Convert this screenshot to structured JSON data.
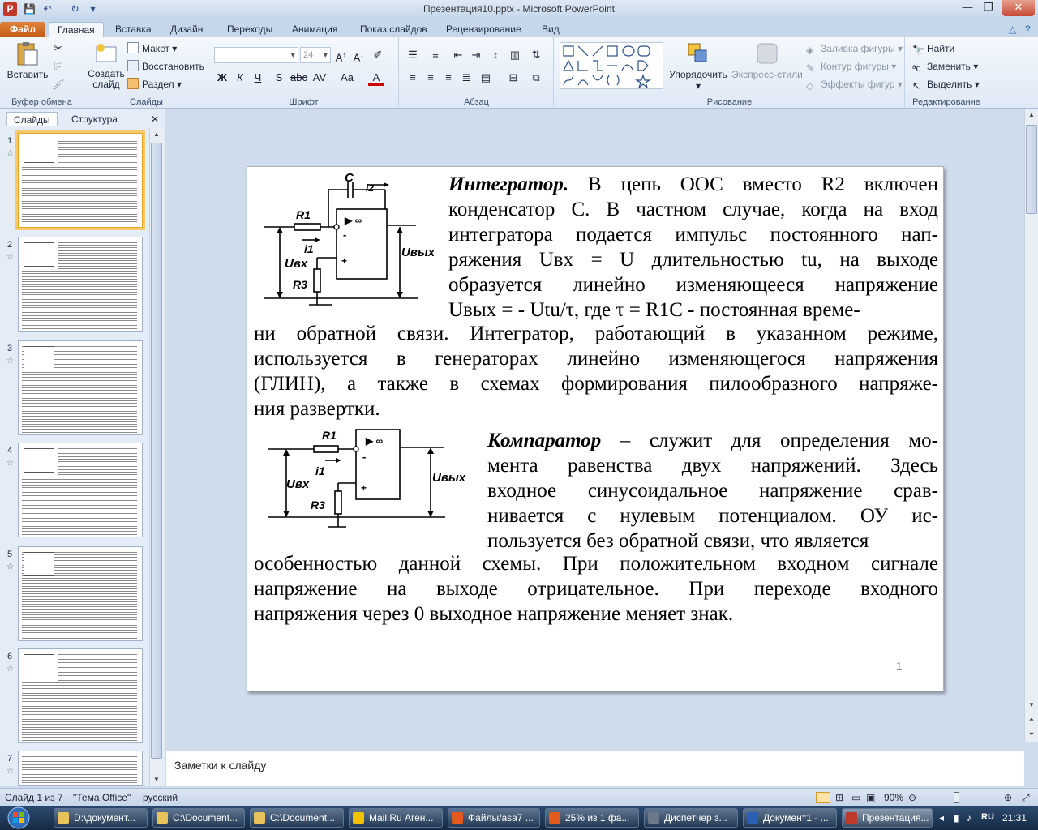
{
  "window": {
    "title": "Презентация10.pptx - Microsoft PowerPoint"
  },
  "tabs": [
    {
      "label": "Файл"
    },
    {
      "label": "Главная"
    },
    {
      "label": "Вставка"
    },
    {
      "label": "Дизайн"
    },
    {
      "label": "Переходы"
    },
    {
      "label": "Анимация"
    },
    {
      "label": "Показ слайдов"
    },
    {
      "label": "Рецензирование"
    },
    {
      "label": "Вид"
    }
  ],
  "ribbon": {
    "clipboard": {
      "paste": "Вставить",
      "label": "Буфер обмена"
    },
    "slides": {
      "create": "Создать слайд",
      "layout": "Макет",
      "reset": "Восстановить",
      "section": "Раздел",
      "label": "Слайды"
    },
    "font": {
      "size": "24",
      "label": "Шрифт"
    },
    "paragraph": {
      "label": "Абзац"
    },
    "drawing": {
      "arrange": "Упорядочить",
      "quick_styles": "Экспресс-стили",
      "fill": "Заливка фигуры",
      "outline": "Контур фигуры",
      "effects": "Эффекты фигур",
      "label": "Рисование"
    },
    "editing": {
      "find": "Найти",
      "replace": "Заменить",
      "select": "Выделить",
      "label": "Редактирование"
    }
  },
  "left_panel": {
    "tabs": [
      "Слайды",
      "Структура"
    ],
    "slide_numbers": [
      "1",
      "2",
      "3",
      "4",
      "5",
      "6",
      "7"
    ]
  },
  "slide": {
    "heading1": "Интегратор.",
    "p1_lines": [
      " В цепь ООС вместо R2 включен",
      "конденсатор С. В частном случае, когда на вход",
      "интегратора подается импульс постоянного нап-",
      "ряжения Uвх = U длительностью tu, на выходе",
      "образуется линейно изменяющееся напряжение",
      "Uвых = - Utu/τ, где τ = R1C - постоянная време-",
      "ни обратной связи. Интегратор, работающий в указанном режиме,",
      "используется в генераторах линейно изменяющегося напряжения",
      "(ГЛИН), а также в схемах формирования пилообразного напряже-",
      "ния развертки."
    ],
    "heading2": "Компаратор",
    "p2_lines": [
      " – служит для определения мо-",
      "мента равенства двух напряжений. Здесь",
      "входное синусоидальное напряжение срав-",
      "нивается с нулевым потенциалом. ОУ ис-",
      "пользуется без обратной связи, что является",
      "особенностью данной схемы. При положительном входном сигнале",
      "напряжение на выходе отрицательное. При переходе входного",
      "напряжения через 0 выходное напряжение меняет знак."
    ],
    "circuit1": {
      "c": "C",
      "i2": "i2",
      "r1": "R1",
      "i1": "i1",
      "uin": "Uвх",
      "uout": "Uвых",
      "r3": "R3",
      "opamp": "▶ ∞",
      "minus": "-",
      "plus": "+"
    },
    "circuit2": {
      "r1": "R1",
      "i1": "i1",
      "uin": "Uвх",
      "uout": "Uвых",
      "r3": "R3",
      "opamp": "▶ ∞",
      "minus": "-",
      "plus": "+"
    },
    "page_number": "1"
  },
  "notes": {
    "placeholder": "Заметки к слайду"
  },
  "status": {
    "slide_info": "Слайд 1 из 7",
    "theme": "\"Тема Office\"",
    "language": "русский",
    "zoom": "90%"
  },
  "taskbar": {
    "items": [
      "D:\\документ...",
      "C:\\Document...",
      "C:\\Document...",
      "Mail.Ru Аген...",
      "Файлы/asa7 ...",
      "25% из 1 фа...",
      "Диспетчер з...",
      "Документ1 - ...",
      "Презентация..."
    ],
    "language": "RU",
    "clock": "21:31"
  },
  "colors": {
    "accent": "#d2691e",
    "ribbon_bg": "#dfe9f5",
    "selection": "#f5c96c"
  }
}
